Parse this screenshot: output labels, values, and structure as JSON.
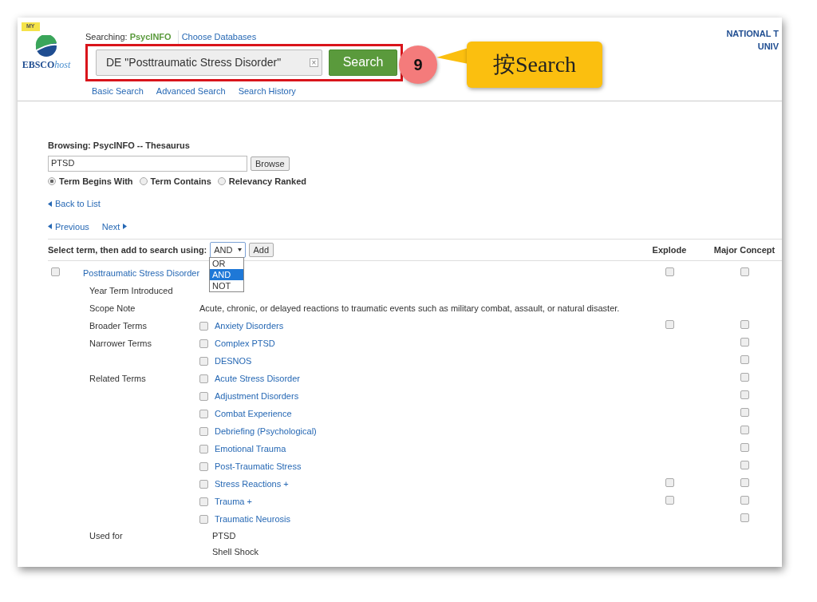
{
  "header": {
    "badge": "MY",
    "logo_main": "EBSCO",
    "logo_sub": "host",
    "searching_label": "Searching:",
    "database": "PsycINFO",
    "choose_link": "Choose Databases",
    "search_value": "DE \"Posttraumatic Stress Disorder\"",
    "clear": "×",
    "search_button": "Search",
    "links": [
      "Basic Search",
      "Advanced Search",
      "Search History"
    ],
    "institution": [
      "NATIONAL T",
      "UNIV"
    ]
  },
  "callout": {
    "step": "9",
    "text": "按Search"
  },
  "browse": {
    "title": "Browsing: PsycINFO -- Thesaurus",
    "value": "PTSD",
    "button": "Browse",
    "options": [
      {
        "label": "Term Begins With",
        "selected": true
      },
      {
        "label": "Term Contains",
        "selected": false
      },
      {
        "label": "Relevancy Ranked",
        "selected": false
      }
    ],
    "back": "Back to List",
    "previous": "Previous",
    "next": "Next"
  },
  "add_bar": {
    "label": "Select term, then add to search using:",
    "operator": "AND",
    "button": "Add",
    "columns": [
      "Explode",
      "Major Concept"
    ],
    "dropdown": [
      {
        "label": "OR",
        "selected": false
      },
      {
        "label": "AND",
        "selected": true
      },
      {
        "label": "NOT",
        "selected": false
      }
    ]
  },
  "term": {
    "label": "Posttraumatic Stress Disorder",
    "checked": false,
    "explode": false,
    "major": false
  },
  "details": [
    {
      "kind": "text",
      "label": "Year Term Introduced"
    },
    {
      "kind": "text",
      "label": "Scope Note",
      "value": "Acute, chronic, or delayed reactions to traumatic events such as military combat, assault, or natural disaster."
    },
    {
      "kind": "terms",
      "label": "Broader Terms",
      "terms": [
        {
          "label": "Anxiety Disorders",
          "checked": false,
          "has_explode": true,
          "explode": false,
          "major": false
        }
      ]
    },
    {
      "kind": "terms",
      "label": "Narrower Terms",
      "terms": [
        {
          "label": "Complex PTSD",
          "checked": false,
          "has_explode": false,
          "major": false
        },
        {
          "label": "DESNOS",
          "checked": false,
          "has_explode": false,
          "major": false
        }
      ]
    },
    {
      "kind": "terms",
      "label": "Related Terms",
      "terms": [
        {
          "label": "Acute Stress Disorder",
          "checked": false,
          "has_explode": false,
          "major": false
        },
        {
          "label": "Adjustment Disorders",
          "checked": false,
          "has_explode": false,
          "major": false
        },
        {
          "label": "Combat Experience",
          "checked": false,
          "has_explode": false,
          "major": false
        },
        {
          "label": "Debriefing (Psychological)",
          "checked": false,
          "has_explode": false,
          "major": false
        },
        {
          "label": "Emotional Trauma",
          "checked": false,
          "has_explode": false,
          "major": false
        },
        {
          "label": "Post-Traumatic Stress",
          "checked": false,
          "has_explode": false,
          "major": false
        },
        {
          "label": "Stress Reactions +",
          "checked": false,
          "has_explode": true,
          "explode": false,
          "major": false
        },
        {
          "label": "Trauma +",
          "checked": false,
          "has_explode": true,
          "explode": false,
          "major": false
        },
        {
          "label": "Traumatic Neurosis",
          "checked": false,
          "has_explode": false,
          "major": false
        }
      ]
    },
    {
      "kind": "list",
      "label": "Used for",
      "items": [
        "PTSD",
        "Shell Shock"
      ]
    }
  ]
}
